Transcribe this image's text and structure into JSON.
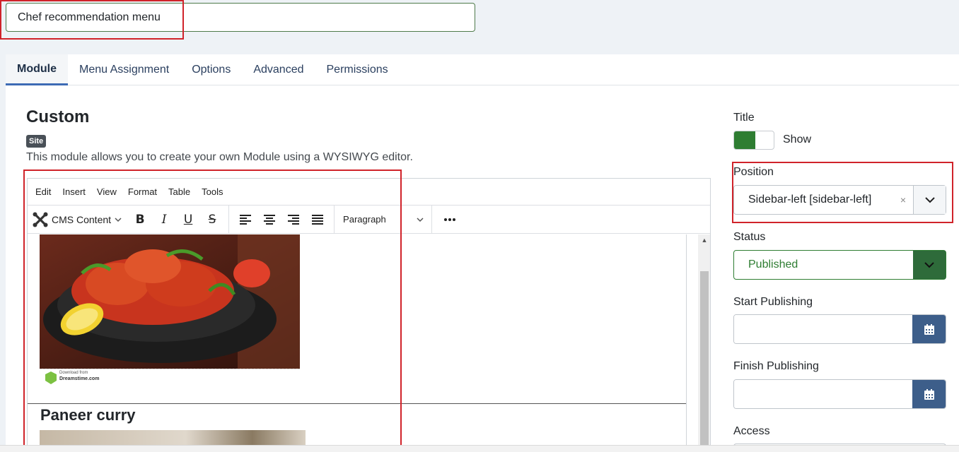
{
  "module_title": "Chef recommendation menu",
  "tabs": [
    {
      "label": "Module"
    },
    {
      "label": "Menu Assignment"
    },
    {
      "label": "Options"
    },
    {
      "label": "Advanced"
    },
    {
      "label": "Permissions"
    }
  ],
  "module": {
    "name": "Custom",
    "badge": "Site",
    "description": "This module allows you to create your own Module using a WYSIWYG editor."
  },
  "editor": {
    "menu": [
      "Edit",
      "Insert",
      "View",
      "Format",
      "Table",
      "Tools"
    ],
    "cms_content_label": "CMS Content",
    "format_select": "Paragraph",
    "content": {
      "dish_heading": "Paneer curry",
      "image_credit": "Download from",
      "image_site": "Dreamstime.com"
    }
  },
  "sidebar": {
    "title_label": "Title",
    "title_toggle": "Show",
    "position_label": "Position",
    "position_value": "Sidebar-left [sidebar-left]",
    "status_label": "Status",
    "status_value": "Published",
    "start_label": "Start Publishing",
    "finish_label": "Finish Publishing",
    "access_label": "Access"
  },
  "colors": {
    "accent_blue": "#3d5e8a",
    "published_green": "#2e7d32",
    "highlight_red": "#d0232a"
  }
}
